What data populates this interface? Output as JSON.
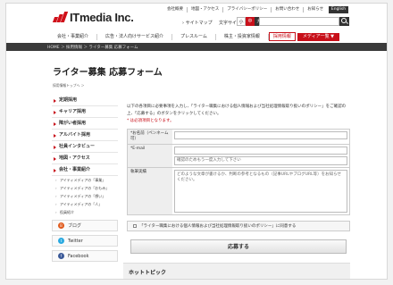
{
  "header": {
    "logo_text": "ITmedia Inc.",
    "top_links": [
      "会社概要",
      "地図・アクセス",
      "プライバシーポリシー",
      "お問い合わせ",
      "お知らせ"
    ],
    "english": "English",
    "sitemap": "› サイトマップ",
    "font_size_label": "文字サイズ",
    "font_sizes": [
      "小",
      "中",
      "大"
    ],
    "search_placeholder": ""
  },
  "nav": {
    "items": [
      "会社・事業紹介",
      "広告・法人向けサービス紹介",
      "プレスルーム",
      "株主・投資家情報"
    ],
    "active": "採用情報",
    "media": "メディア一覧 ▼"
  },
  "breadcrumb": "HOME ＞ 採用情報 ＞ ライター募集 応募フォーム",
  "page_title": "ライター募集 応募フォーム",
  "sub_breadcrumb": "採用情報トップへ ＞",
  "sidebar": {
    "items": [
      "定期採用",
      "キャリア採用",
      "障がい者採用",
      "アルバイト採用",
      "社員インタビュー",
      "地図・アクセス",
      "会社・事業紹介"
    ],
    "subs": [
      "アイティメディアの「事業」",
      "アイティメディアの「おもみ」",
      "アイティメディアの「想い」",
      "アイティメディアの「人」",
      "役員紹介"
    ],
    "buttons": [
      {
        "label": "ブログ",
        "color": "#e05a1c",
        "icon": "blog-icon"
      },
      {
        "label": "Twitter",
        "color": "#29a9e0",
        "icon": "twitter-icon"
      },
      {
        "label": "Facebook",
        "color": "#3b5998",
        "icon": "facebook-icon"
      }
    ]
  },
  "intro": {
    "line1": "以下の各項目に必要事項を入力し、「ライター職集における個人情報および当社処理情報取り扱いのポリシー」をご確認の上、「応募する」のボタンをクリックしてください。",
    "required": "* は必須項目となります。"
  },
  "form": {
    "name_label": "*お名前（ペンネーム可）",
    "name_value": "",
    "email_label": "*E-mail",
    "email_placeholder": "確認のためもう一度入力して下さい",
    "career_label": "執筆実績",
    "career_placeholder": "どのような文章が書けるか、判断の参考となるもの（記事URLやブログURL等）をお知らせください。"
  },
  "agree_text": "「ライター職集における個人情報および当社処理情報取り扱いのポリシー」に同意する",
  "submit_label": "応募する",
  "hot_topic": "ホットトピック"
}
